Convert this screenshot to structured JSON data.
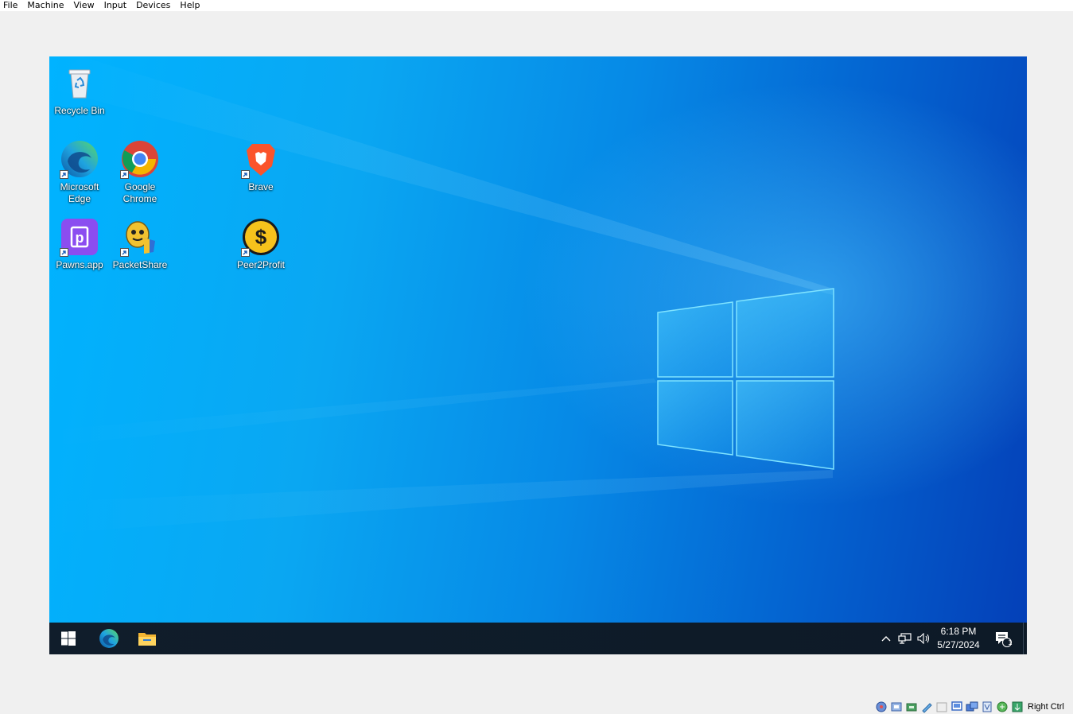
{
  "host_menu": {
    "items": [
      "File",
      "Machine",
      "View",
      "Input",
      "Devices",
      "Help"
    ]
  },
  "desktop": {
    "icons": [
      {
        "label": "Recycle Bin",
        "icon": "recycle-bin-icon"
      },
      {
        "label": "Microsoft Edge",
        "icon": "edge-icon"
      },
      {
        "label": "Google Chrome",
        "icon": "chrome-icon"
      },
      {
        "label": "Brave",
        "icon": "brave-icon"
      },
      {
        "label": "Pawns.app",
        "icon": "pawns-icon"
      },
      {
        "label": "PacketShare",
        "icon": "packetshare-icon"
      },
      {
        "label": "Peer2Profit",
        "icon": "peer2profit-icon"
      }
    ]
  },
  "taskbar": {
    "pinned": [
      "start-icon",
      "edge-icon",
      "file-explorer-icon"
    ],
    "clock": {
      "time": "6:18 PM",
      "date": "5/27/2024"
    },
    "notification_count": "1"
  },
  "statusbar": {
    "host_key": "Right Ctrl"
  },
  "colors": {
    "taskbar": "#0d1a27",
    "wallpaper_light": "#00b3ff",
    "wallpaper_dark": "#0440b8"
  }
}
